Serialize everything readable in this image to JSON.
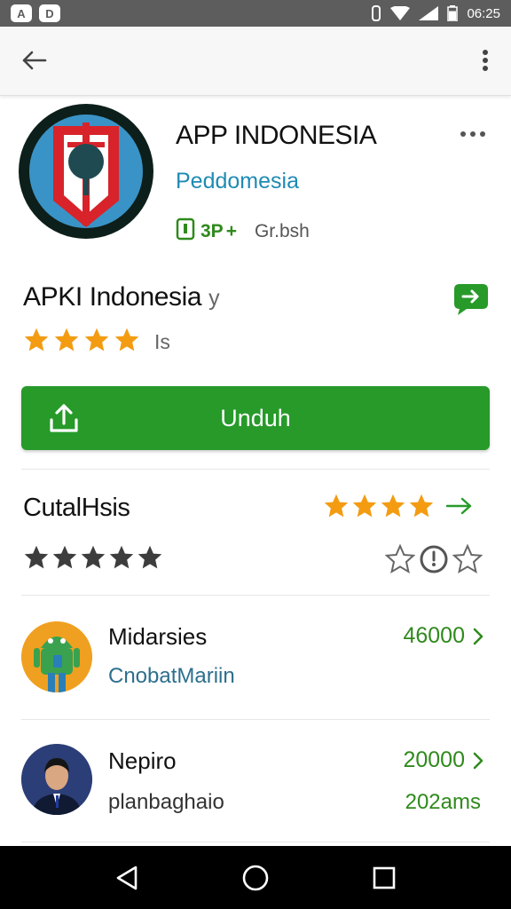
{
  "status_bar": {
    "left_badges": [
      "A",
      "D"
    ],
    "time": "06:25",
    "battery_level": 0.75
  },
  "app_bar": {
    "back_icon": "arrow-left-icon",
    "overflow_icon": "more-vert-icon"
  },
  "app": {
    "title": "APP INDONESIA",
    "developer": "Peddomesia",
    "content_rating": "3P",
    "rating_plus": "+",
    "category": "Gr.bsh",
    "name": "APKI Indonesia",
    "name_suffix": "y",
    "stars": 4,
    "rating_text": "Is",
    "colors": {
      "accent": "#279a2a",
      "developer": "#1f8bb3",
      "star": "#f39c12"
    }
  },
  "install": {
    "label": "Unduh",
    "icon": "upload-icon"
  },
  "reviews": {
    "title": "CutalHsis",
    "stars": 4,
    "dark_stars": 5,
    "outline_icons": [
      "star-outline-icon",
      "clock-icon",
      "star-outline-icon"
    ]
  },
  "list": [
    {
      "title": "Midarsies",
      "subtitle": "CnobatMariin",
      "value": "46000",
      "avatar": "android-icon"
    },
    {
      "title": "Nepiro",
      "subtitle": "planbaghaio",
      "value": "20000",
      "value2": "202ams",
      "avatar": "person-avatar"
    }
  ],
  "nav_bar": {
    "icons": [
      "back-triangle-icon",
      "home-circle-icon",
      "recents-square-icon"
    ]
  }
}
